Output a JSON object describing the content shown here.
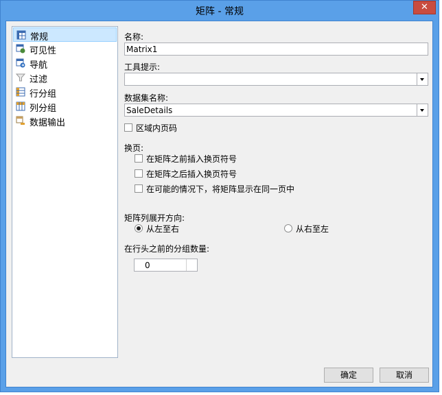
{
  "window": {
    "title": "矩阵 - 常规",
    "close_glyph": "✕"
  },
  "nav": {
    "items": [
      {
        "label": "常规",
        "icon": "matrix-general-icon",
        "selected": true
      },
      {
        "label": "可见性",
        "icon": "visibility-icon",
        "selected": false
      },
      {
        "label": "导航",
        "icon": "navigation-icon",
        "selected": false
      },
      {
        "label": "过滤",
        "icon": "filter-funnel-icon",
        "selected": false
      },
      {
        "label": "行分组",
        "icon": "row-group-icon",
        "selected": false
      },
      {
        "label": "列分组",
        "icon": "column-group-icon",
        "selected": false
      },
      {
        "label": "数据输出",
        "icon": "data-output-icon",
        "selected": false
      }
    ]
  },
  "form": {
    "name_label": "名称:",
    "name_value": "Matrix1",
    "tooltip_label": "工具提示:",
    "tooltip_value": "",
    "dataset_label": "数据集名称:",
    "dataset_value": "SaleDetails",
    "page_in_region_label": "区域内页码",
    "page_in_region_checked": false,
    "page_break_label": "换页:",
    "page_break_options": [
      {
        "label": "在矩阵之前插入换页符号",
        "checked": false
      },
      {
        "label": "在矩阵之后插入换页符号",
        "checked": false
      },
      {
        "label": "在可能的情况下，将矩阵显示在同一页中",
        "checked": false
      }
    ],
    "direction_label": "矩阵列展开方向:",
    "direction_options": [
      {
        "label": "从左至右",
        "selected": true
      },
      {
        "label": "从右至左",
        "selected": false
      }
    ],
    "groups_before_label": "在行头之前的分组数量:",
    "groups_before_value": "0"
  },
  "buttons": {
    "ok": "确定",
    "cancel": "取消"
  },
  "colors": {
    "accent": "#5aa0e8",
    "selection": "#cce8ff",
    "close": "#c94c3f"
  }
}
